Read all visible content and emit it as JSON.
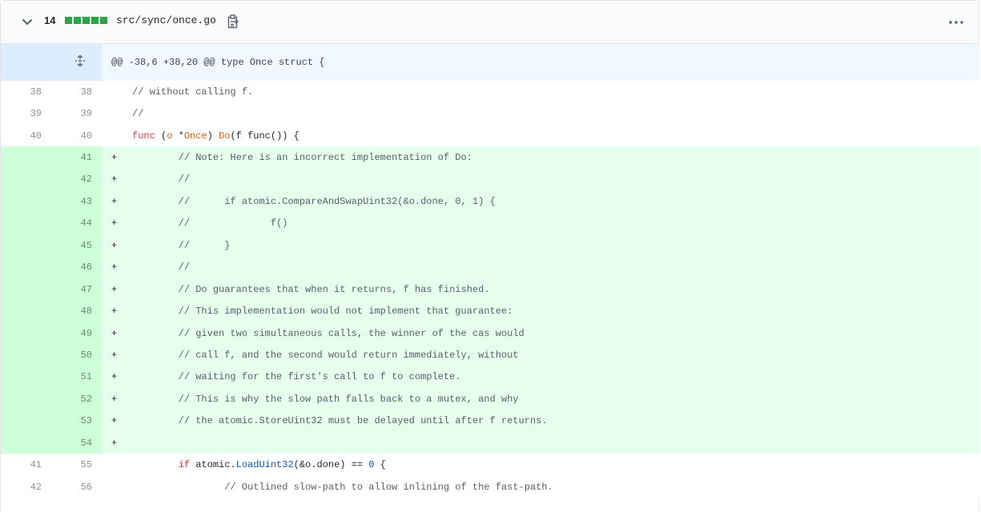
{
  "file": {
    "changes_count": "14",
    "diffstat_blocks": 5,
    "diffstat_color": "#28a745",
    "path": "src/sync/once.go",
    "icons": {
      "expand": "chevron-down-icon",
      "copy": "clipboard-icon",
      "more": "kebab-horizontal-icon",
      "unfold": "unfold-icon"
    }
  },
  "hunk": {
    "header": "@@ -38,6 +38,20 @@ type Once struct {"
  },
  "lines": [
    {
      "type": "ctx",
      "old": "38",
      "new": "38",
      "marker": "",
      "segments": [
        [
          "cm",
          "// without calling f."
        ]
      ]
    },
    {
      "type": "ctx",
      "old": "39",
      "new": "39",
      "marker": "",
      "segments": [
        [
          "cm",
          "//"
        ]
      ]
    },
    {
      "type": "ctx",
      "old": "40",
      "new": "40",
      "marker": "",
      "segments": [
        [
          "kw",
          "func"
        ],
        [
          "pl",
          " ("
        ],
        [
          "typ",
          "o"
        ],
        [
          "pl",
          " *"
        ],
        [
          "typ",
          "Once"
        ],
        [
          "pl",
          ") "
        ],
        [
          "typ",
          "Do"
        ],
        [
          "pl",
          "(f func()) {"
        ]
      ]
    },
    {
      "type": "add",
      "old": "",
      "new": "41",
      "marker": "+",
      "segments": [
        [
          "cm",
          "\t// Note: Here is an incorrect implementation of Do:"
        ]
      ]
    },
    {
      "type": "add",
      "old": "",
      "new": "42",
      "marker": "+",
      "segments": [
        [
          "cm",
          "\t//"
        ]
      ]
    },
    {
      "type": "add",
      "old": "",
      "new": "43",
      "marker": "+",
      "segments": [
        [
          "cm",
          "\t//\tif atomic.CompareAndSwapUint32(&o.done, 0, 1) {"
        ]
      ]
    },
    {
      "type": "add",
      "old": "",
      "new": "44",
      "marker": "+",
      "segments": [
        [
          "cm",
          "\t//\t\tf()"
        ]
      ]
    },
    {
      "type": "add",
      "old": "",
      "new": "45",
      "marker": "+",
      "segments": [
        [
          "cm",
          "\t//\t}"
        ]
      ]
    },
    {
      "type": "add",
      "old": "",
      "new": "46",
      "marker": "+",
      "segments": [
        [
          "cm",
          "\t//"
        ]
      ]
    },
    {
      "type": "add",
      "old": "",
      "new": "47",
      "marker": "+",
      "segments": [
        [
          "cm",
          "\t// Do guarantees that when it returns, f has finished."
        ]
      ]
    },
    {
      "type": "add",
      "old": "",
      "new": "48",
      "marker": "+",
      "segments": [
        [
          "cm",
          "\t// This implementation would not implement that guarantee:"
        ]
      ]
    },
    {
      "type": "add",
      "old": "",
      "new": "49",
      "marker": "+",
      "segments": [
        [
          "cm",
          "\t// given two simultaneous calls, the winner of the cas would"
        ]
      ]
    },
    {
      "type": "add",
      "old": "",
      "new": "50",
      "marker": "+",
      "segments": [
        [
          "cm",
          "\t// call f, and the second would return immediately, without"
        ]
      ]
    },
    {
      "type": "add",
      "old": "",
      "new": "51",
      "marker": "+",
      "segments": [
        [
          "cm",
          "\t// waiting for the first's call to f to complete."
        ]
      ]
    },
    {
      "type": "add",
      "old": "",
      "new": "52",
      "marker": "+",
      "segments": [
        [
          "cm",
          "\t// This is why the slow path falls back to a mutex, and why"
        ]
      ]
    },
    {
      "type": "add",
      "old": "",
      "new": "53",
      "marker": "+",
      "segments": [
        [
          "cm",
          "\t// the atomic.StoreUint32 must be delayed until after f returns."
        ]
      ]
    },
    {
      "type": "add",
      "old": "",
      "new": "54",
      "marker": "+",
      "segments": []
    },
    {
      "type": "ctx",
      "old": "41",
      "new": "55",
      "marker": "",
      "segments": [
        [
          "pl",
          "\t"
        ],
        [
          "kw",
          "if"
        ],
        [
          "pl",
          " atomic."
        ],
        [
          "fn",
          "LoadUint32"
        ],
        [
          "pl",
          "(&o.done) == "
        ],
        [
          "num-lit",
          "0"
        ],
        [
          "pl",
          " {"
        ]
      ]
    },
    {
      "type": "ctx",
      "old": "42",
      "new": "56",
      "marker": "",
      "segments": [
        [
          "cm",
          "\t\t// Outlined slow-path to allow inlining of the fast-path."
        ]
      ]
    }
  ]
}
